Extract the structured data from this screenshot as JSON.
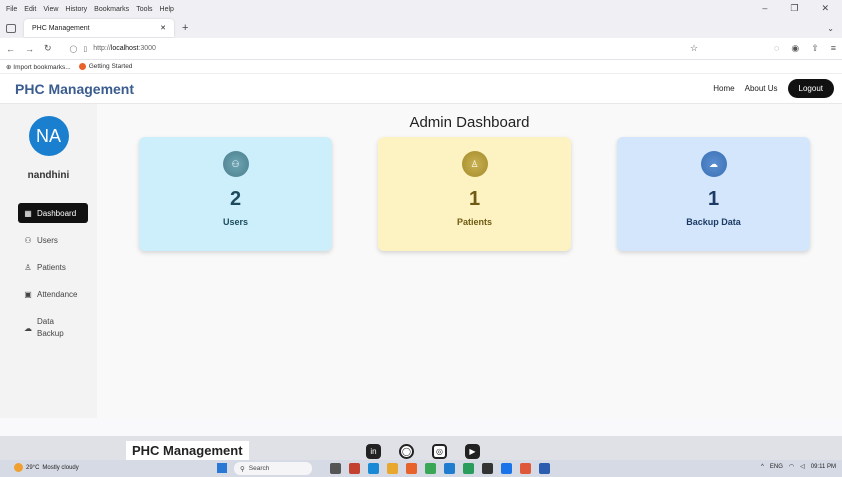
{
  "browser": {
    "menu": [
      "File",
      "Edit",
      "View",
      "History",
      "Bookmarks",
      "Tools",
      "Help"
    ],
    "tab_title": "PHC Management",
    "url_prefix": "http://",
    "url_host": "localhost",
    "url_port": ":3000",
    "bookmarks": [
      "Import bookmarks...",
      "Getting Started"
    ]
  },
  "app": {
    "brand": "PHC Management",
    "nav": [
      "Home",
      "About Us"
    ],
    "logout_label": "Logout"
  },
  "sidebar": {
    "avatar_initials": "NA",
    "username": "nandhini",
    "items": [
      {
        "label": "Dashboard",
        "icon": "grid-icon",
        "active": true
      },
      {
        "label": "Users",
        "icon": "users-icon"
      },
      {
        "label": "Patients",
        "icon": "user-icon"
      },
      {
        "label": "Attendance",
        "icon": "calendar-icon"
      },
      {
        "label": "Data Backup",
        "icon": "cloud-upload-icon"
      }
    ]
  },
  "dashboard": {
    "title": "Admin Dashboard",
    "cards": [
      {
        "label": "Users",
        "count": "2",
        "icon": "users-icon",
        "color": "#cdeffb"
      },
      {
        "label": "Patients",
        "count": "1",
        "icon": "user-icon",
        "color": "#fdf3c2"
      },
      {
        "label": "Backup Data",
        "count": "1",
        "icon": "cloud-upload-icon",
        "color": "#d3e6fb"
      }
    ]
  },
  "footer": {
    "brand": "PHC Management",
    "socials": [
      "linkedin-icon",
      "github-icon",
      "instagram-icon",
      "youtube-icon"
    ]
  },
  "taskbar": {
    "temperature": "29°C",
    "weather": "Mostly cloudy",
    "search_placeholder": "Search",
    "lang": "ENG",
    "time": "09:11 PM"
  }
}
